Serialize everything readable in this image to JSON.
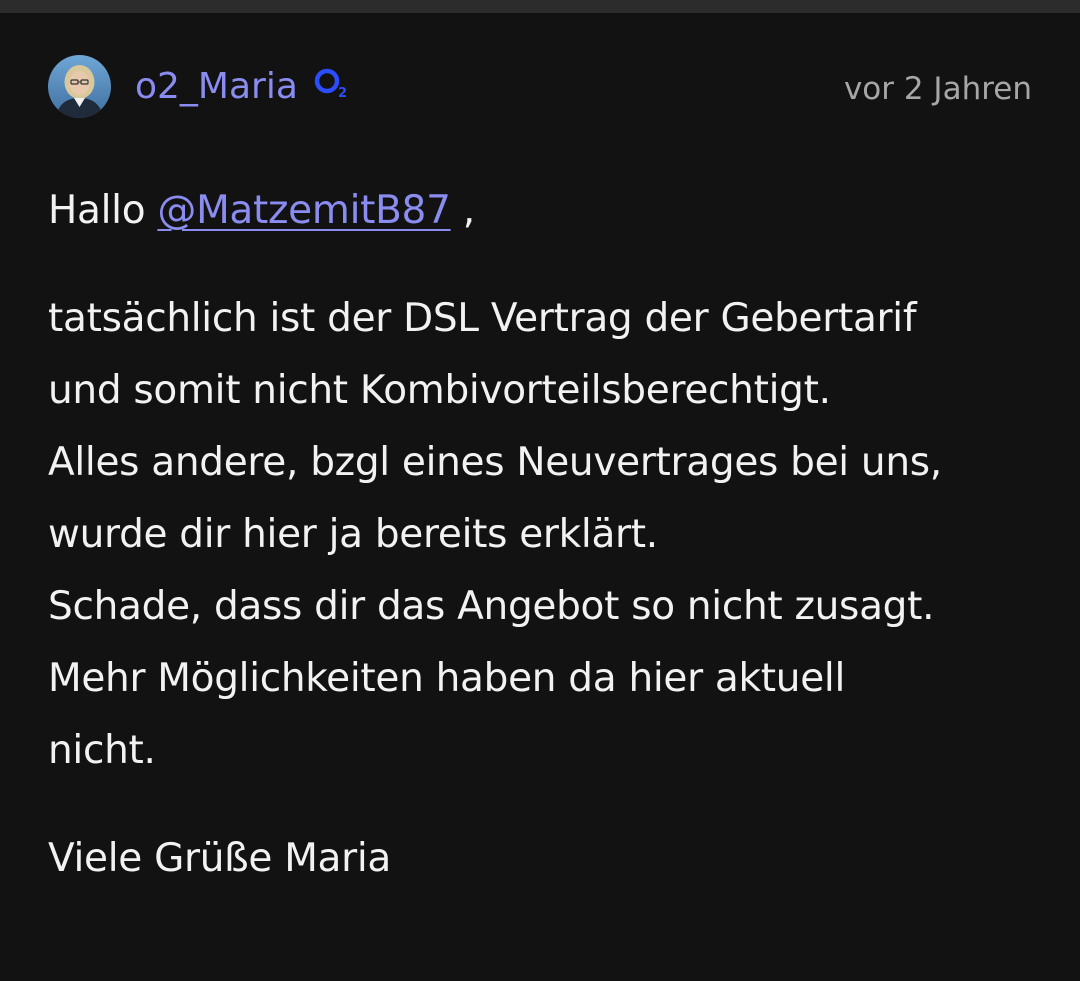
{
  "post": {
    "author": {
      "name": "o2_Maria",
      "avatar_icon": "avatar-photo",
      "badge_icon": "o2-brand-icon",
      "badge_text": "O2"
    },
    "timestamp": "vor 2 Jahren",
    "greeting_prefix": "Hallo",
    "mention": "@MatzemitB87",
    "greeting_suffix": " ,",
    "paragraph_lines": [
      "tatsächlich ist der DSL Vertrag der Gebertarif",
      "und somit nicht Kombivorteilsberechtigt.",
      "Alles andere, bzgl eines Neuvertrages bei uns,",
      "wurde dir hier ja bereits erklärt.",
      "Schade, dass dir das Angebot so nicht zusagt.",
      "Mehr Möglichkeiten haben da hier aktuell",
      "nicht."
    ],
    "signature": "Viele Grüße Maria"
  },
  "colors": {
    "background": "#121212",
    "text": "#f2f2f2",
    "accent": "#8a8cf0",
    "muted": "#a6a6a6",
    "brand_blue": "#2b4cff"
  }
}
